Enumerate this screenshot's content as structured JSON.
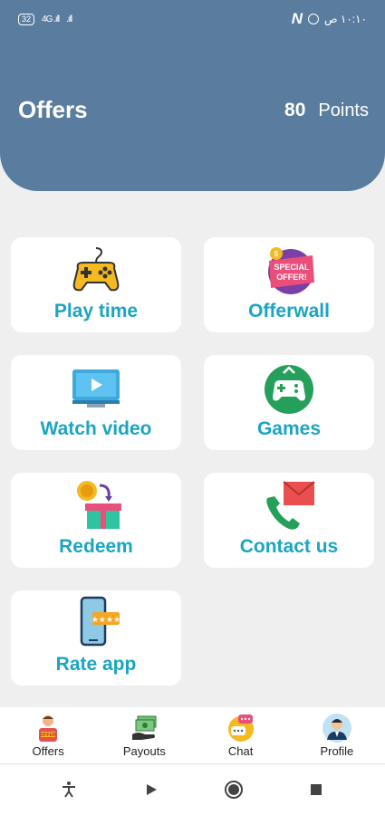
{
  "status_bar": {
    "battery": "32",
    "signal_1": "4G .ıll",
    "signal_2": ".ıll",
    "time": "١٠:١٠ ص"
  },
  "header": {
    "title": "Offers",
    "points_value": "80",
    "points_label": "Points"
  },
  "cards": [
    {
      "label": "Play time",
      "icon": "gamepad-icon"
    },
    {
      "label": "Offerwall",
      "icon": "special-offer-icon"
    },
    {
      "label": "Watch video",
      "icon": "video-monitor-icon"
    },
    {
      "label": "Games",
      "icon": "controller-icon"
    },
    {
      "label": "Redeem",
      "icon": "coin-gift-icon"
    },
    {
      "label": "Contact us",
      "icon": "phone-mail-icon"
    },
    {
      "label": "Rate app",
      "icon": "phone-rating-icon"
    }
  ],
  "bottom_nav": [
    {
      "label": "Offers",
      "icon": "offer-person-icon"
    },
    {
      "label": "Payouts",
      "icon": "money-hand-icon"
    },
    {
      "label": "Chat",
      "icon": "chat-bubble-icon"
    },
    {
      "label": "Profile",
      "icon": "user-avatar-icon"
    }
  ],
  "colors": {
    "header_bg": "#5a7d9f",
    "accent_text": "#1aa5c0",
    "page_bg": "#efefef"
  }
}
